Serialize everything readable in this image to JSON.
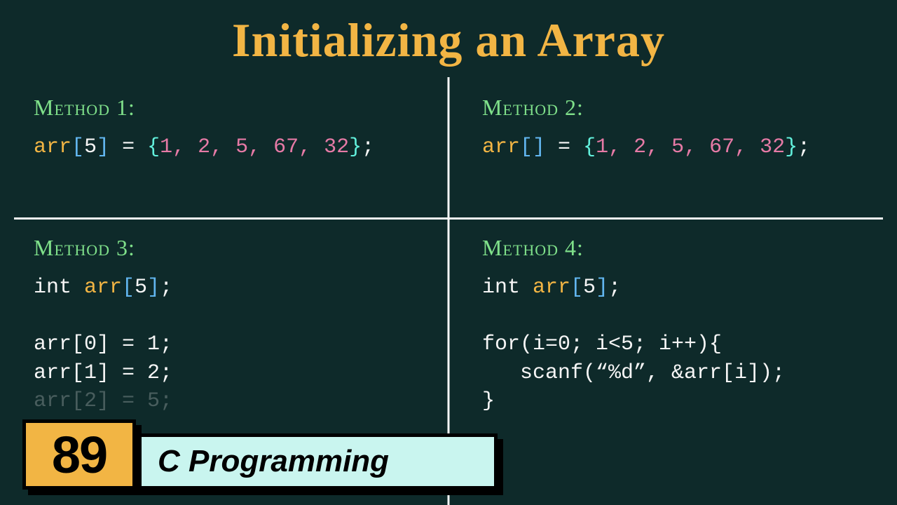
{
  "title": "Initializing an Array",
  "methods": {
    "m1": {
      "label": "Method 1:"
    },
    "m2": {
      "label": "Method 2:"
    },
    "m3": {
      "label": "Method 3:"
    },
    "m4": {
      "label": "Method 4:"
    }
  },
  "code": {
    "m1": {
      "arr": "arr",
      "lb": "[",
      "idx": "5",
      "rb": "]",
      "eq": " = ",
      "lc": "{",
      "vals": "1, 2, 5, 67, 32",
      "rc": "}",
      "end": ";"
    },
    "m2": {
      "arr": "arr",
      "lb": "[",
      "rb": "]",
      "eq": " = ",
      "lc": "{",
      "vals": "1, 2, 5, 67, 32",
      "rc": "}",
      "end": ";"
    },
    "m3": {
      "l1a": "int ",
      "l1b": "arr",
      "l1c": "[",
      "l1d": "5",
      "l1e": "]",
      "l1f": ";",
      "l2": "arr[0] = 1;",
      "l3": "arr[1] = 2;",
      "l4partial": "arr[2] = 5;"
    },
    "m4": {
      "l1a": "int ",
      "l1b": "arr",
      "l1c": "[",
      "l1d": "5",
      "l1e": "]",
      "l1f": ";",
      "l2": "for(i=0; i<5; i++){",
      "l3": "   scanf(“%d”, &arr[i]);",
      "l4": "}"
    }
  },
  "badge": {
    "number": "89",
    "text": "C Programming"
  }
}
